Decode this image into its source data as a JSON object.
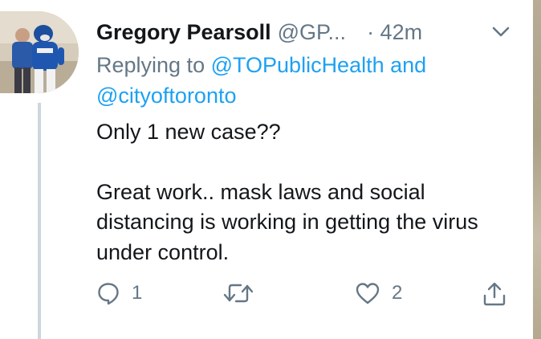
{
  "tweet": {
    "author_name": "Gregory Pearsoll",
    "author_handle": "@GP...",
    "time": "· 42m",
    "reply_prefix": "Replying to",
    "reply_mention_1": "@TOPublicHealth",
    "reply_and": "and",
    "reply_mention_2": "@cityoftoronto",
    "text_line_1": "Only 1 new case??",
    "text_para_2": "Great work.. mask laws and social distancing is working in getting the virus under control."
  },
  "actions": {
    "reply_count": "1",
    "retweet_count": "",
    "like_count": "2"
  },
  "icons": {
    "reply": "reply-icon",
    "retweet": "retweet-icon",
    "like": "heart-icon",
    "share": "share-icon",
    "menu": "chevron-down-icon"
  },
  "colors": {
    "link": "#1da1f2",
    "secondary_text": "#657786",
    "primary_text": "#14171a",
    "thread_line": "#ccd6dd"
  }
}
